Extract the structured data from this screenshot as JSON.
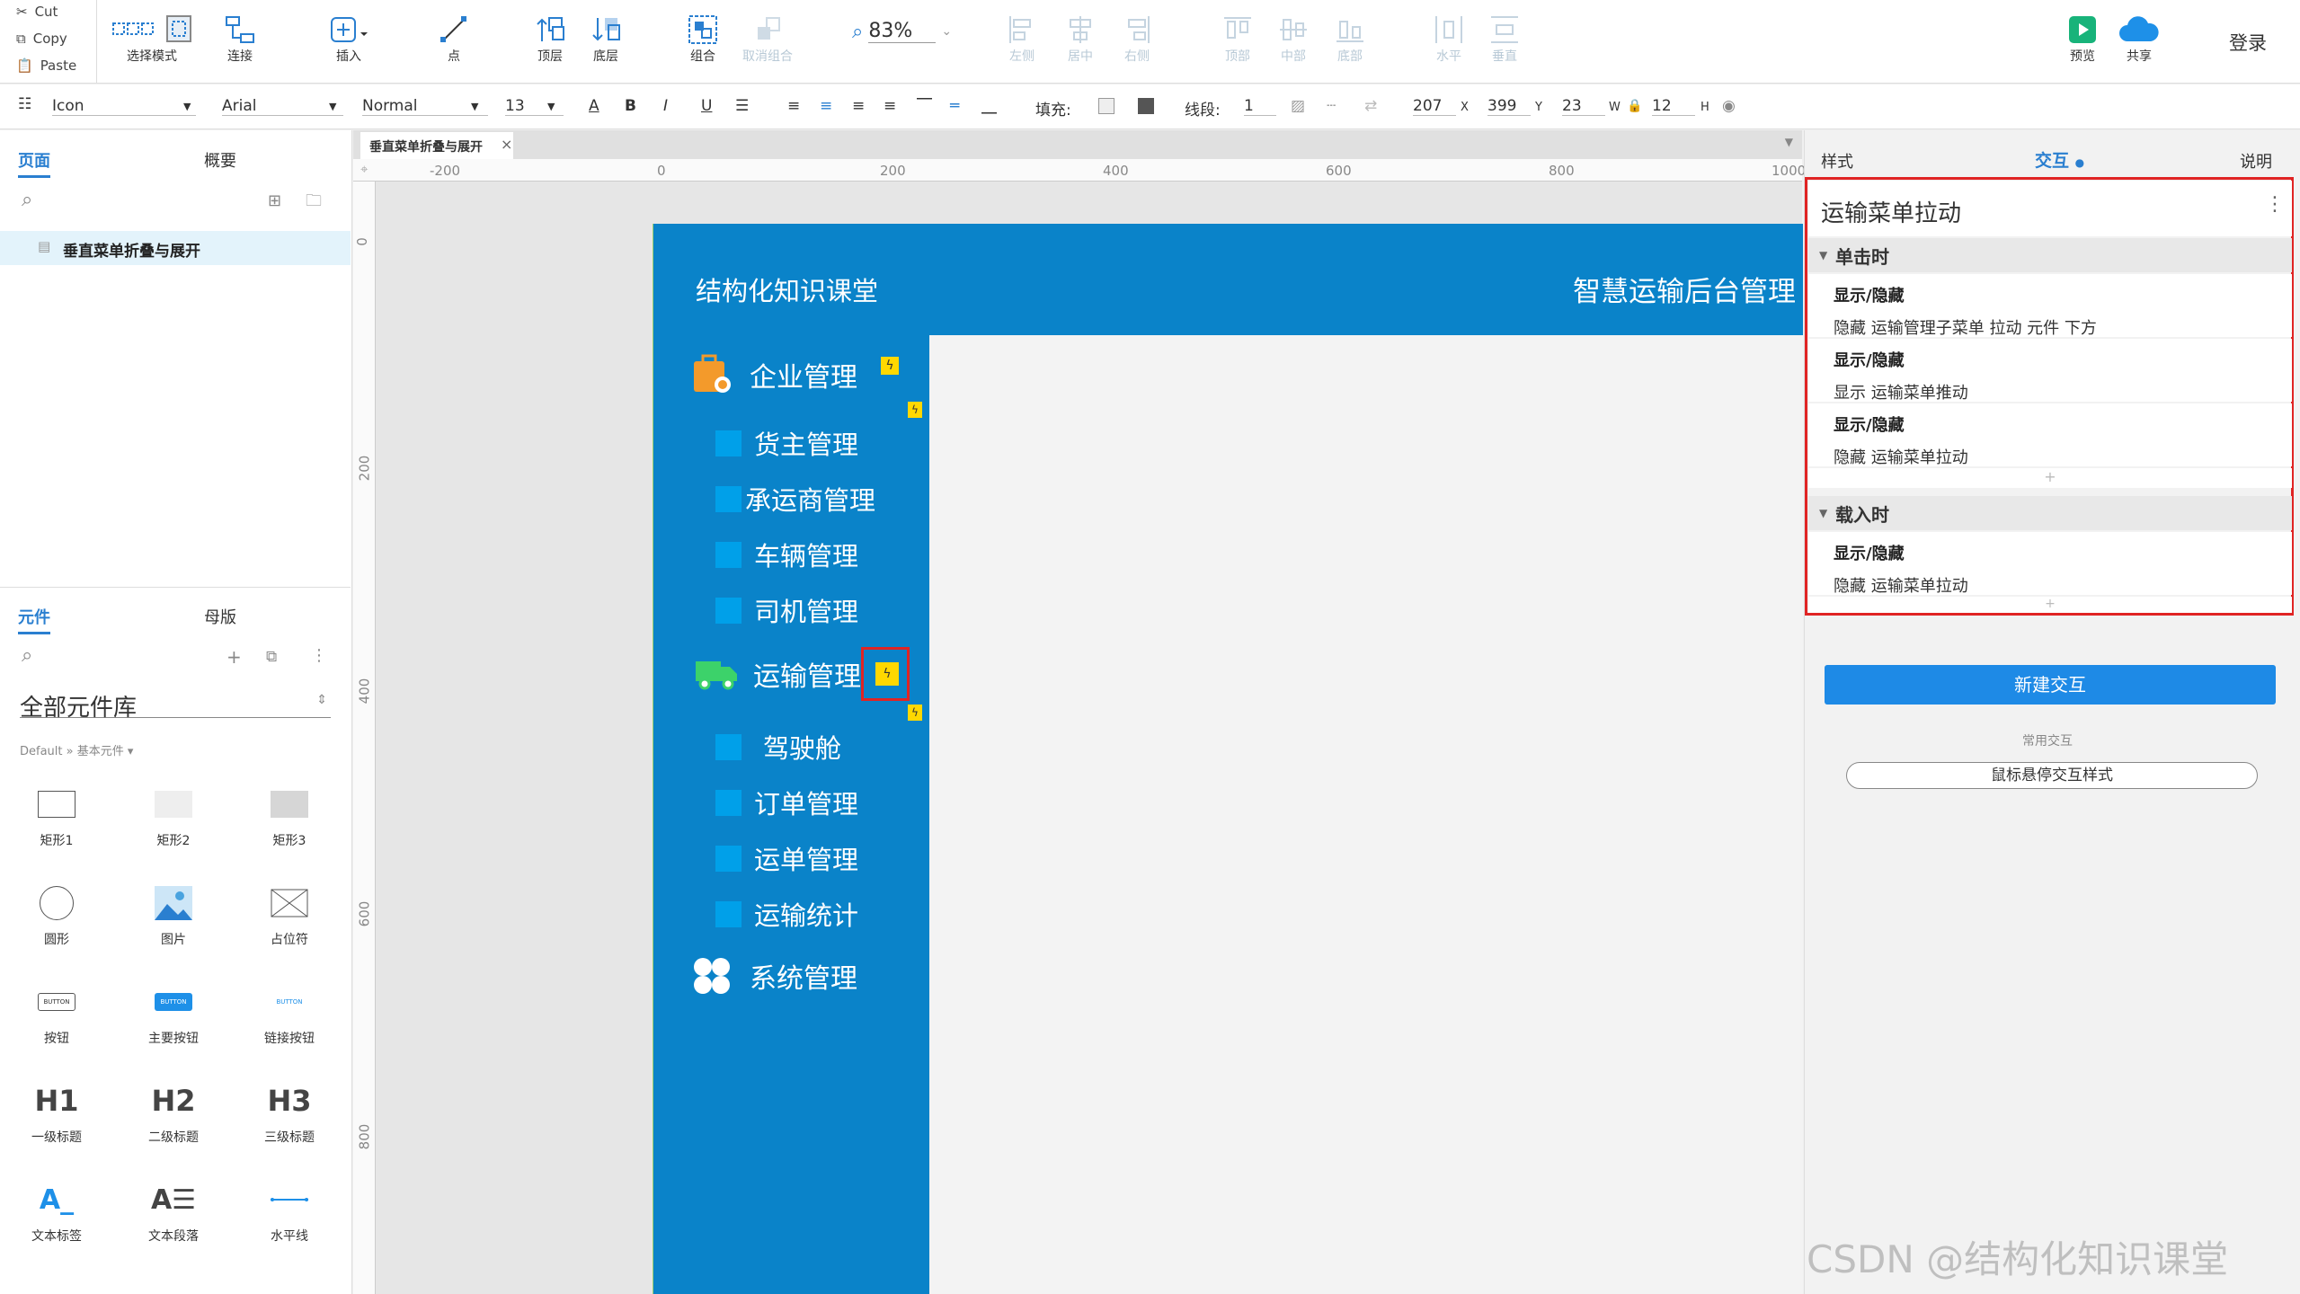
{
  "clipboard": {
    "cut": "Cut",
    "copy": "Copy",
    "paste": "Paste"
  },
  "toolbar": {
    "select_mode": "选择模式",
    "connect": "连接",
    "insert": "插入",
    "point": "点",
    "top_layer": "顶层",
    "bottom_layer": "底层",
    "group": "组合",
    "ungroup": "取消组合",
    "zoom": "83%",
    "align_left": "左侧",
    "align_center": "居中",
    "align_right": "右侧",
    "align_top": "顶部",
    "align_middle": "中部",
    "align_bottom": "底部",
    "dist_h": "水平",
    "dist_v": "垂直",
    "preview": "预览",
    "share": "共享",
    "login": "登录"
  },
  "format": {
    "style_select": "Icon",
    "font": "Arial",
    "weight": "Normal",
    "size": "13",
    "fill_label": "填充:",
    "line_label": "线段:",
    "line_value": "1",
    "x": "207",
    "x_label": "X",
    "y": "399",
    "y_label": "Y",
    "w": "23",
    "w_label": "W",
    "h": "12",
    "h_label": "H"
  },
  "left": {
    "tab_pages": "页面",
    "tab_outline": "概要",
    "page_item": "垂直菜单折叠与展开",
    "tab_widgets": "元件",
    "tab_masters": "母版",
    "library": "全部元件库",
    "library_sub": "Default » 基本元件 ▾",
    "widgets": [
      "矩形1",
      "矩形2",
      "矩形3",
      "圆形",
      "图片",
      "占位符",
      "按钮",
      "主要按钮",
      "链接按钮",
      "一级标题",
      "二级标题",
      "三级标题",
      "文本标签",
      "文本段落",
      "水平线"
    ]
  },
  "canvas": {
    "doc_tab": "垂直菜单折叠与展开",
    "h_ticks": [
      "-200",
      "0",
      "200",
      "400",
      "600",
      "800",
      "1000"
    ],
    "v_ticks": [
      "0",
      "200",
      "400",
      "600",
      "800"
    ],
    "header_left": "结构化知识课堂",
    "header_right": "智慧运输后台管理",
    "menu": {
      "enterprise": "企业管理",
      "enterprise_sub": [
        "货主管理",
        "承运商管理",
        "车辆管理",
        "司机管理"
      ],
      "transport": "运输管理",
      "transport_sub": [
        "驾驶舱",
        "订单管理",
        "运单管理",
        "运输统计"
      ],
      "system": "系统管理"
    }
  },
  "right": {
    "tab_style": "样式",
    "tab_interact": "交互",
    "tab_notes": "说明",
    "title": "运输菜单拉动",
    "on_click": "单击时",
    "click_actions": [
      {
        "name": "显示/隐藏",
        "desc": "隐藏 运输管理子菜单  拉动 元件 下方"
      },
      {
        "name": "显示/隐藏",
        "desc": "显示 运输菜单推动"
      },
      {
        "name": "显示/隐藏",
        "desc": "隐藏 运输菜单拉动"
      }
    ],
    "on_load": "载入时",
    "load_actions": [
      {
        "name": "显示/隐藏",
        "desc": "隐藏 运输菜单拉动"
      }
    ],
    "new_interaction": "新建交互",
    "common_label": "常用交互",
    "hover_style": "鼠标悬停交互样式",
    "watermark": "CSDN @结构化知识课堂"
  }
}
